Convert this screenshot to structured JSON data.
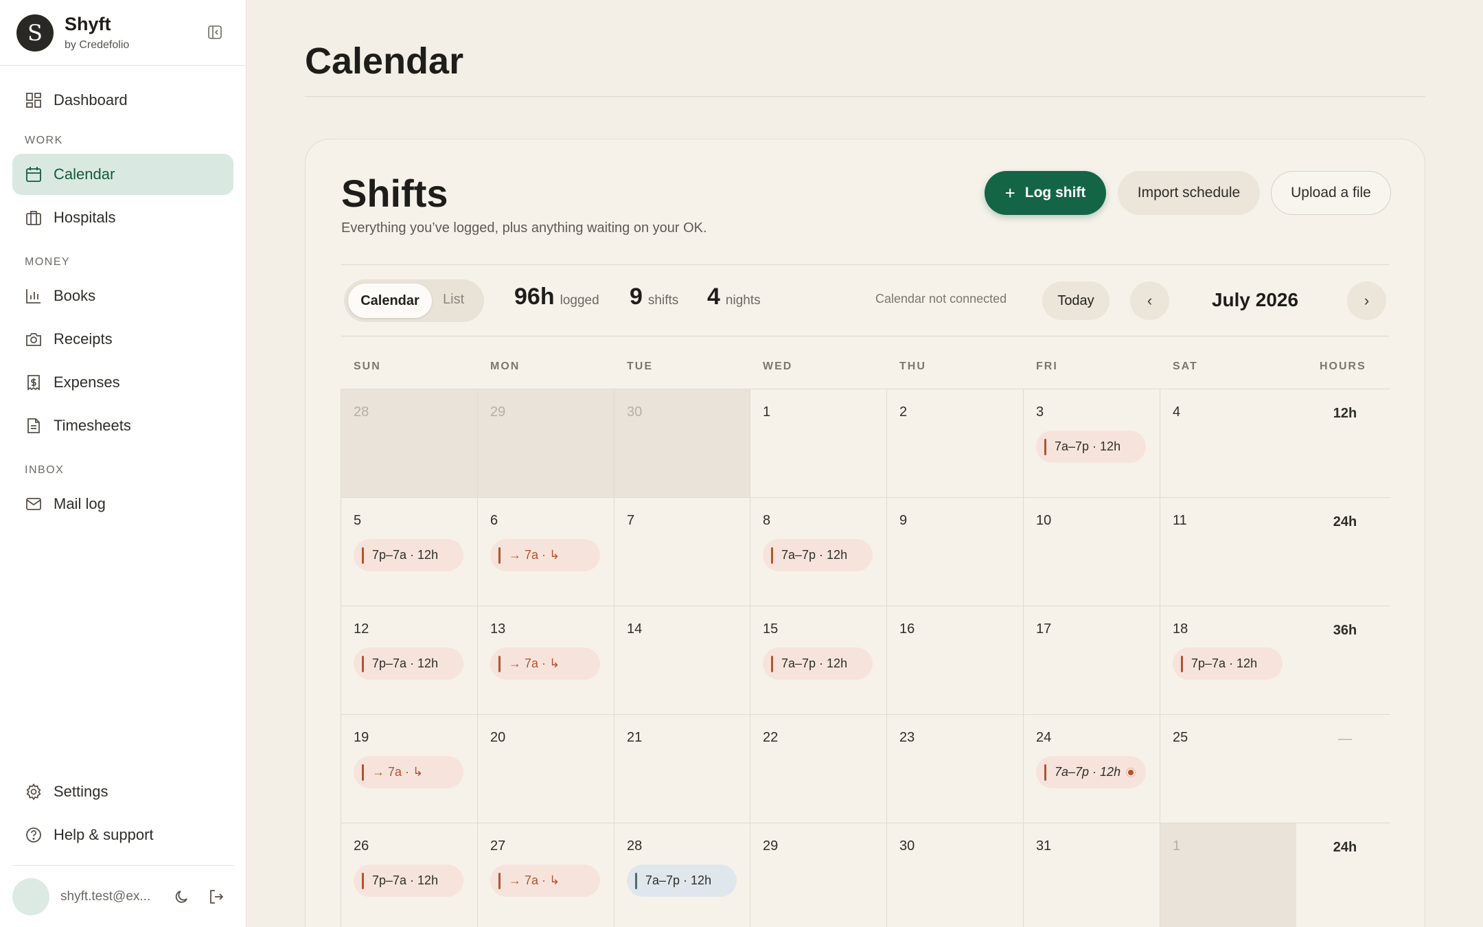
{
  "brand": {
    "initial": "S",
    "name": "Shyft",
    "sub": "by Credefolio"
  },
  "nav": {
    "dashboard": "Dashboard",
    "section_work": "WORK",
    "calendar": "Calendar",
    "hospitals": "Hospitals",
    "section_money": "MONEY",
    "books": "Books",
    "receipts": "Receipts",
    "expenses": "Expenses",
    "timesheets": "Timesheets",
    "section_inbox": "INBOX",
    "mail_log": "Mail log",
    "settings": "Settings",
    "help": "Help & support"
  },
  "user": {
    "email": "shyft.test@ex..."
  },
  "page": {
    "title": "Calendar"
  },
  "card": {
    "title": "Shifts",
    "subtitle": "Everything you’ve logged, plus anything waiting on your OK.",
    "log_shift": "Log shift",
    "import_schedule": "Import schedule",
    "upload_file": "Upload a file"
  },
  "toolbar": {
    "view_calendar": "Calendar",
    "view_list": "List",
    "hours_value": "96h",
    "hours_label": "logged",
    "shifts_value": "9",
    "shifts_label": "shifts",
    "nights_value": "4",
    "nights_label": "nights",
    "calendar_status": "Calendar not connected",
    "today": "Today",
    "prev": "‹",
    "next": "›",
    "month": "July 2026"
  },
  "weekdays": [
    "SUN",
    "MON",
    "TUE",
    "WED",
    "THU",
    "FRI",
    "SAT"
  ],
  "hours_header": "HOURS",
  "weeks": [
    {
      "hours": "12h",
      "days": [
        {
          "d": "28",
          "out": true
        },
        {
          "d": "29",
          "out": true
        },
        {
          "d": "30",
          "out": true
        },
        {
          "d": "1"
        },
        {
          "d": "2"
        },
        {
          "d": "3",
          "shift": "7a–7p · 12h",
          "kind": "day"
        },
        {
          "d": "4"
        }
      ]
    },
    {
      "hours": "24h",
      "days": [
        {
          "d": "5",
          "shift": "7p–7a · 12h",
          "kind": "night"
        },
        {
          "d": "6",
          "shift": "→ 7a · ↳",
          "kind": "cont"
        },
        {
          "d": "7"
        },
        {
          "d": "8",
          "shift": "7a–7p · 12h",
          "kind": "day"
        },
        {
          "d": "9"
        },
        {
          "d": "10"
        },
        {
          "d": "11"
        }
      ]
    },
    {
      "hours": "36h",
      "days": [
        {
          "d": "12",
          "shift": "7p–7a · 12h",
          "kind": "night"
        },
        {
          "d": "13",
          "shift": "→ 7a · ↳",
          "kind": "cont"
        },
        {
          "d": "14"
        },
        {
          "d": "15",
          "shift": "7a–7p · 12h",
          "kind": "day"
        },
        {
          "d": "16"
        },
        {
          "d": "17"
        },
        {
          "d": "18",
          "shift": "7p–7a · 12h",
          "kind": "night"
        }
      ]
    },
    {
      "hours": "—",
      "days": [
        {
          "d": "19",
          "shift": "→ 7a · ↳",
          "kind": "cont"
        },
        {
          "d": "20"
        },
        {
          "d": "21"
        },
        {
          "d": "22"
        },
        {
          "d": "23"
        },
        {
          "d": "24",
          "shift": "7a–7p · 12h",
          "kind": "pending"
        },
        {
          "d": "25"
        }
      ]
    },
    {
      "hours": "24h",
      "days": [
        {
          "d": "26",
          "shift": "7p–7a · 12h",
          "kind": "night"
        },
        {
          "d": "27",
          "shift": "→ 7a · ↳",
          "kind": "cont"
        },
        {
          "d": "28",
          "shift": "7a–7p · 12h",
          "kind": "other"
        },
        {
          "d": "29"
        },
        {
          "d": "30"
        },
        {
          "d": "31"
        },
        {
          "d": "1",
          "out": true
        }
      ]
    }
  ]
}
